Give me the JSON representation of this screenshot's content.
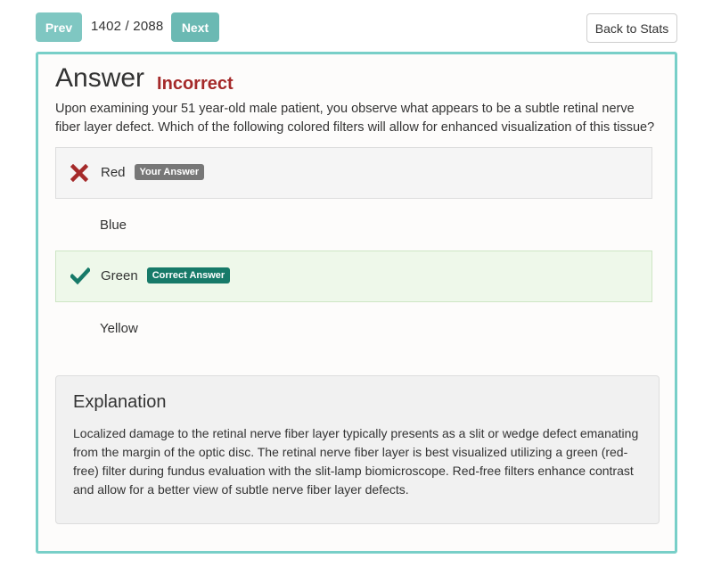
{
  "nav": {
    "prev_label": "Prev",
    "counter": "1402 / 2088",
    "next_label": "Next",
    "back_label": "Back to Stats"
  },
  "card": {
    "title": "Answer",
    "result": "Incorrect",
    "question": "Upon examining your 51 year-old male patient, you observe what appears to be a subtle retinal nerve fiber layer defect. Which of the following colored filters will allow for enhanced visualization of this tissue?",
    "options": [
      {
        "label": "Red",
        "badge": "Your Answer",
        "status": "wrong",
        "icon": "x-icon"
      },
      {
        "label": "Blue"
      },
      {
        "label": "Green",
        "badge": "Correct Answer",
        "status": "correct",
        "icon": "check-icon"
      },
      {
        "label": "Yellow"
      }
    ],
    "explanation": {
      "title": "Explanation",
      "text": "Localized damage to the retinal nerve fiber layer typically presents as a slit or wedge defect emanating from the margin of the optic disc. The retinal nerve fiber layer is best visualized utilizing a green (red-free) filter during fundus evaluation with the slit-lamp biomicroscope. Red-free filters enhance contrast and allow for a better view of subtle nerve fiber layer defects."
    }
  },
  "colors": {
    "accent": "#78cfc8",
    "incorrect": "#a52a2a",
    "correct_icon": "#177a69",
    "wrong_icon": "#a52a2a"
  }
}
